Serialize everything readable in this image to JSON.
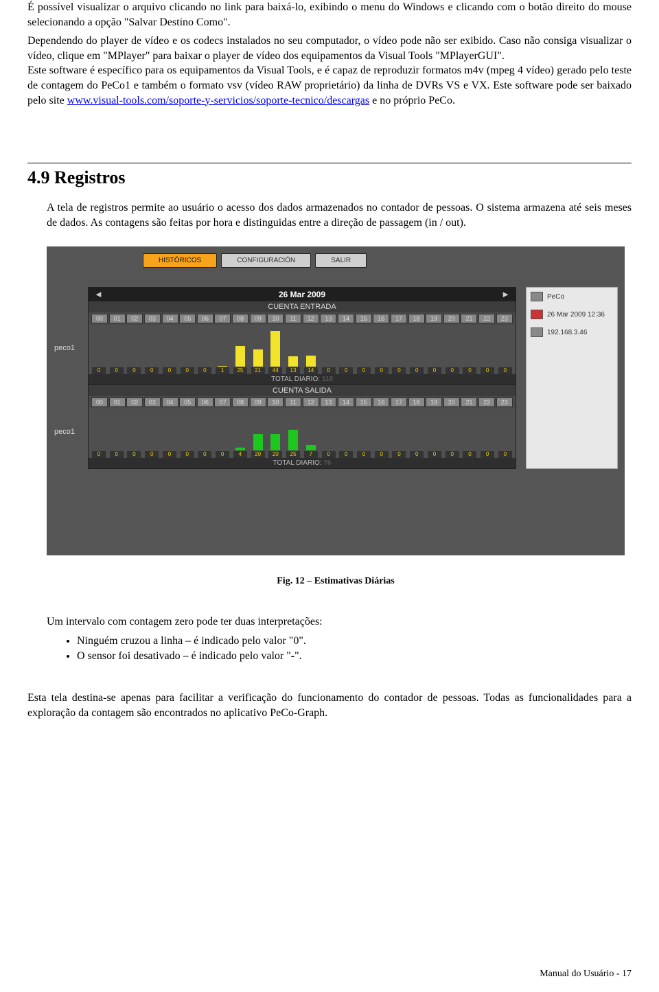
{
  "para1": "É possível visualizar o arquivo clicando no link para baixá-lo, exibindo o menu do Windows e clicando com o botão direito do mouse selecionando a opção \"Salvar Destino Como\".",
  "para2a": "Dependendo do player de vídeo e os codecs instalados no seu computador, o vídeo pode não ser exibido. Caso não consiga visualizar o vídeo, clique em \"MPlayer\" para baixar o player de vídeo dos equipamentos da Visual Tools \"MPlayerGUI\".",
  "para2b": "Este software é específico para os equipamentos da Visual Tools, e é capaz de reproduzir formatos m4v (mpeg 4 vídeo) gerado pelo teste de contagem do PeCo1 e também o formato vsv (vídeo RAW proprietário) da linha de DVRs VS e VX. Este software pode ser baixado pelo site ",
  "link1": "www.visual-tools.com/soporte-y-servicios/soporte-tecnico/descargas",
  "para2c": " e no próprio PeCo.",
  "h2": "4.9 Registros",
  "para3": "A tela de registros permite ao usuário o acesso dos dados armazenados no contador de pessoas. O sistema armazena até seis meses de dados. As contagens são feitas por hora e distinguidas entre a direção de passagem (in / out).",
  "figcap": "Fig. 12 – Estimativas Diárias",
  "para4": "Um intervalo com contagem zero pode ter duas interpretações:",
  "bullet1": "Ninguém cruzou a linha – é indicado pelo valor \"0\".",
  "bullet2": "O sensor foi desativado – é indicado pelo valor \"-\".",
  "para5": "Esta tela destina-se apenas para facilitar a verificação do funcionamento do contador de pessoas. Todas as funcionalidades para a exploração da contagem são encontrados no aplicativo PeCo-Graph.",
  "footer": "Manual do Usuário - 17",
  "ui": {
    "tabs": {
      "historicos": "HISTÓRICOS",
      "configuracion": "CONFIGURACIÓN",
      "salir": "SALIR"
    },
    "date": "26 Mar 2009",
    "entrada_title": "CUENTA ENTRADA",
    "salida_title": "CUENTA SALIDA",
    "device_label": "peco1",
    "total_label": "TOTAL DIARIO: ",
    "total_entrada": "118",
    "total_salida": "76",
    "right_panel": {
      "name": "PeCo",
      "datetime": "26 Mar 2009 12:36",
      "ip": "192.168.3.46"
    }
  },
  "chart_data": [
    {
      "type": "bar",
      "title": "CUENTA ENTRADA",
      "device": "peco1",
      "categories": [
        "00",
        "01",
        "02",
        "03",
        "04",
        "05",
        "06",
        "07",
        "08",
        "09",
        "10",
        "11",
        "12",
        "13",
        "14",
        "15",
        "16",
        "17",
        "18",
        "19",
        "20",
        "21",
        "22",
        "23"
      ],
      "values": [
        0,
        0,
        0,
        0,
        0,
        0,
        0,
        1,
        25,
        21,
        44,
        13,
        14,
        0,
        0,
        0,
        0,
        0,
        0,
        0,
        0,
        0,
        0,
        0
      ],
      "total": 118,
      "ylim": [
        0,
        50
      ],
      "color": "yellow",
      "xlabel": "",
      "ylabel": ""
    },
    {
      "type": "bar",
      "title": "CUENTA SALIDA",
      "device": "peco1",
      "categories": [
        "00",
        "01",
        "02",
        "03",
        "04",
        "05",
        "06",
        "07",
        "08",
        "09",
        "10",
        "11",
        "12",
        "13",
        "14",
        "15",
        "16",
        "17",
        "18",
        "19",
        "20",
        "21",
        "22",
        "23"
      ],
      "values": [
        0,
        0,
        0,
        0,
        0,
        0,
        0,
        0,
        4,
        20,
        20,
        25,
        7,
        0,
        0,
        0,
        0,
        0,
        0,
        0,
        0,
        0,
        0,
        0
      ],
      "total": 76,
      "ylim": [
        0,
        50
      ],
      "color": "green",
      "xlabel": "",
      "ylabel": ""
    }
  ]
}
